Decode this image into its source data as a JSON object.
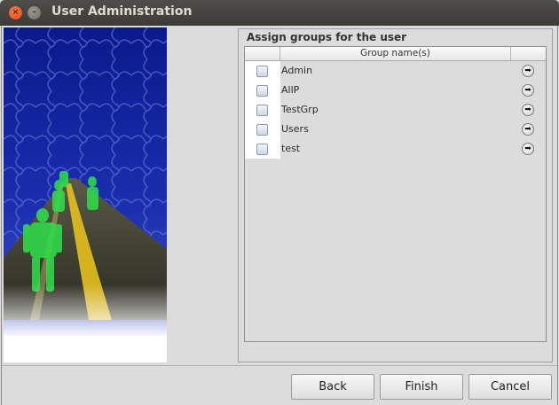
{
  "window": {
    "title": "User Administration",
    "close_glyph": "×",
    "minimize_glyph": "–"
  },
  "panel": {
    "title": "Assign groups for the user",
    "column_header": "Group name(s)"
  },
  "groups": [
    {
      "name": "Admin",
      "checked": false
    },
    {
      "name": "AllP",
      "checked": false
    },
    {
      "name": "TestGrp",
      "checked": false
    },
    {
      "name": "Users",
      "checked": false
    },
    {
      "name": "test",
      "checked": false
    }
  ],
  "buttons": {
    "back_label": "Back",
    "finish_label": "Finish",
    "cancel_label": "Cancel"
  },
  "icons": {
    "row_action": "arrow-right-icon",
    "arrow_glyph": "➡"
  },
  "colors": {
    "titlebar": "#3c3b37",
    "close_button": "#df4a16",
    "window_bg": "#dcdcdc"
  }
}
